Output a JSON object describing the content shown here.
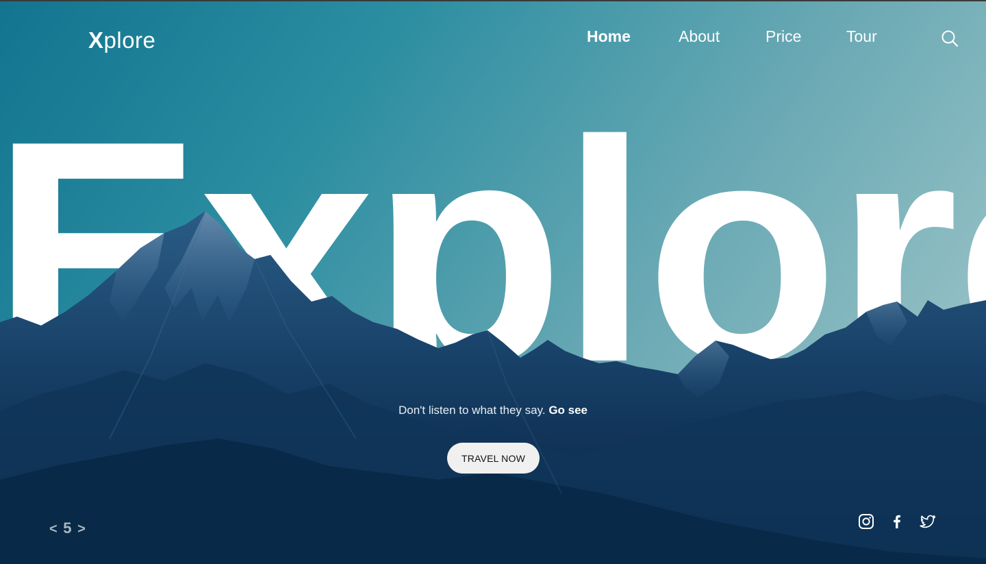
{
  "brand": {
    "logo_x": "X",
    "logo_rest": "plore"
  },
  "nav": {
    "items": [
      {
        "label": "Home",
        "active": true
      },
      {
        "label": "About",
        "active": false
      },
      {
        "label": "Price",
        "active": false
      },
      {
        "label": "Tour",
        "active": false
      }
    ],
    "search_icon": "search-icon"
  },
  "hero": {
    "word": "Explore",
    "tagline_main": "Don't listen to what they say.",
    "tagline_bold": "Go see",
    "cta_label": "TRAVEL NOW"
  },
  "pager": {
    "prev": "<",
    "current": "5",
    "next": ">"
  },
  "social": [
    "instagram-icon",
    "facebook-icon",
    "twitter-icon"
  ],
  "colors": {
    "sky_top": "#12748f",
    "sky_bottom": "#a8cbcd",
    "mountain": "#123f66",
    "mountain_dark": "#0b2a4a",
    "text": "#ffffff",
    "button_bg": "#f0f0f0"
  }
}
